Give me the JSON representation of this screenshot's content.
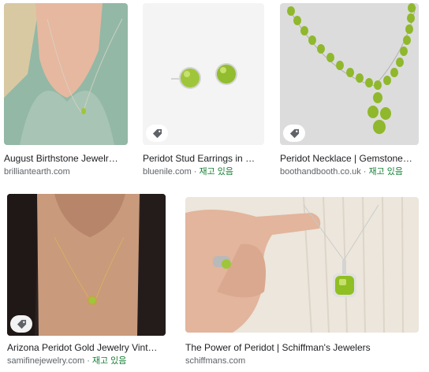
{
  "results": [
    {
      "title": "August Birthstone Jewelr…",
      "source": "brilliantearth.com",
      "stock": ""
    },
    {
      "title": "Peridot Stud Earrings in …",
      "source": "bluenile.com",
      "stock": "재고 있음"
    },
    {
      "title": "Peridot Necklace | Gemstone…",
      "source": "boothandbooth.co.uk",
      "stock": "재고 있음"
    },
    {
      "title": "Arizona Peridot Gold Jewelry Vint…",
      "source": "samifinejewelry.com",
      "stock": "재고 있음"
    },
    {
      "title": "The Power of Peridot | Schiffman's Jewelers",
      "source": "schiffmans.com",
      "stock": ""
    }
  ],
  "colors": {
    "peridot": "#9fc63a",
    "stock": "#188038",
    "text": "#202124",
    "muted": "#5f6368"
  },
  "icons": {
    "shopping_tag": "tag-icon"
  }
}
